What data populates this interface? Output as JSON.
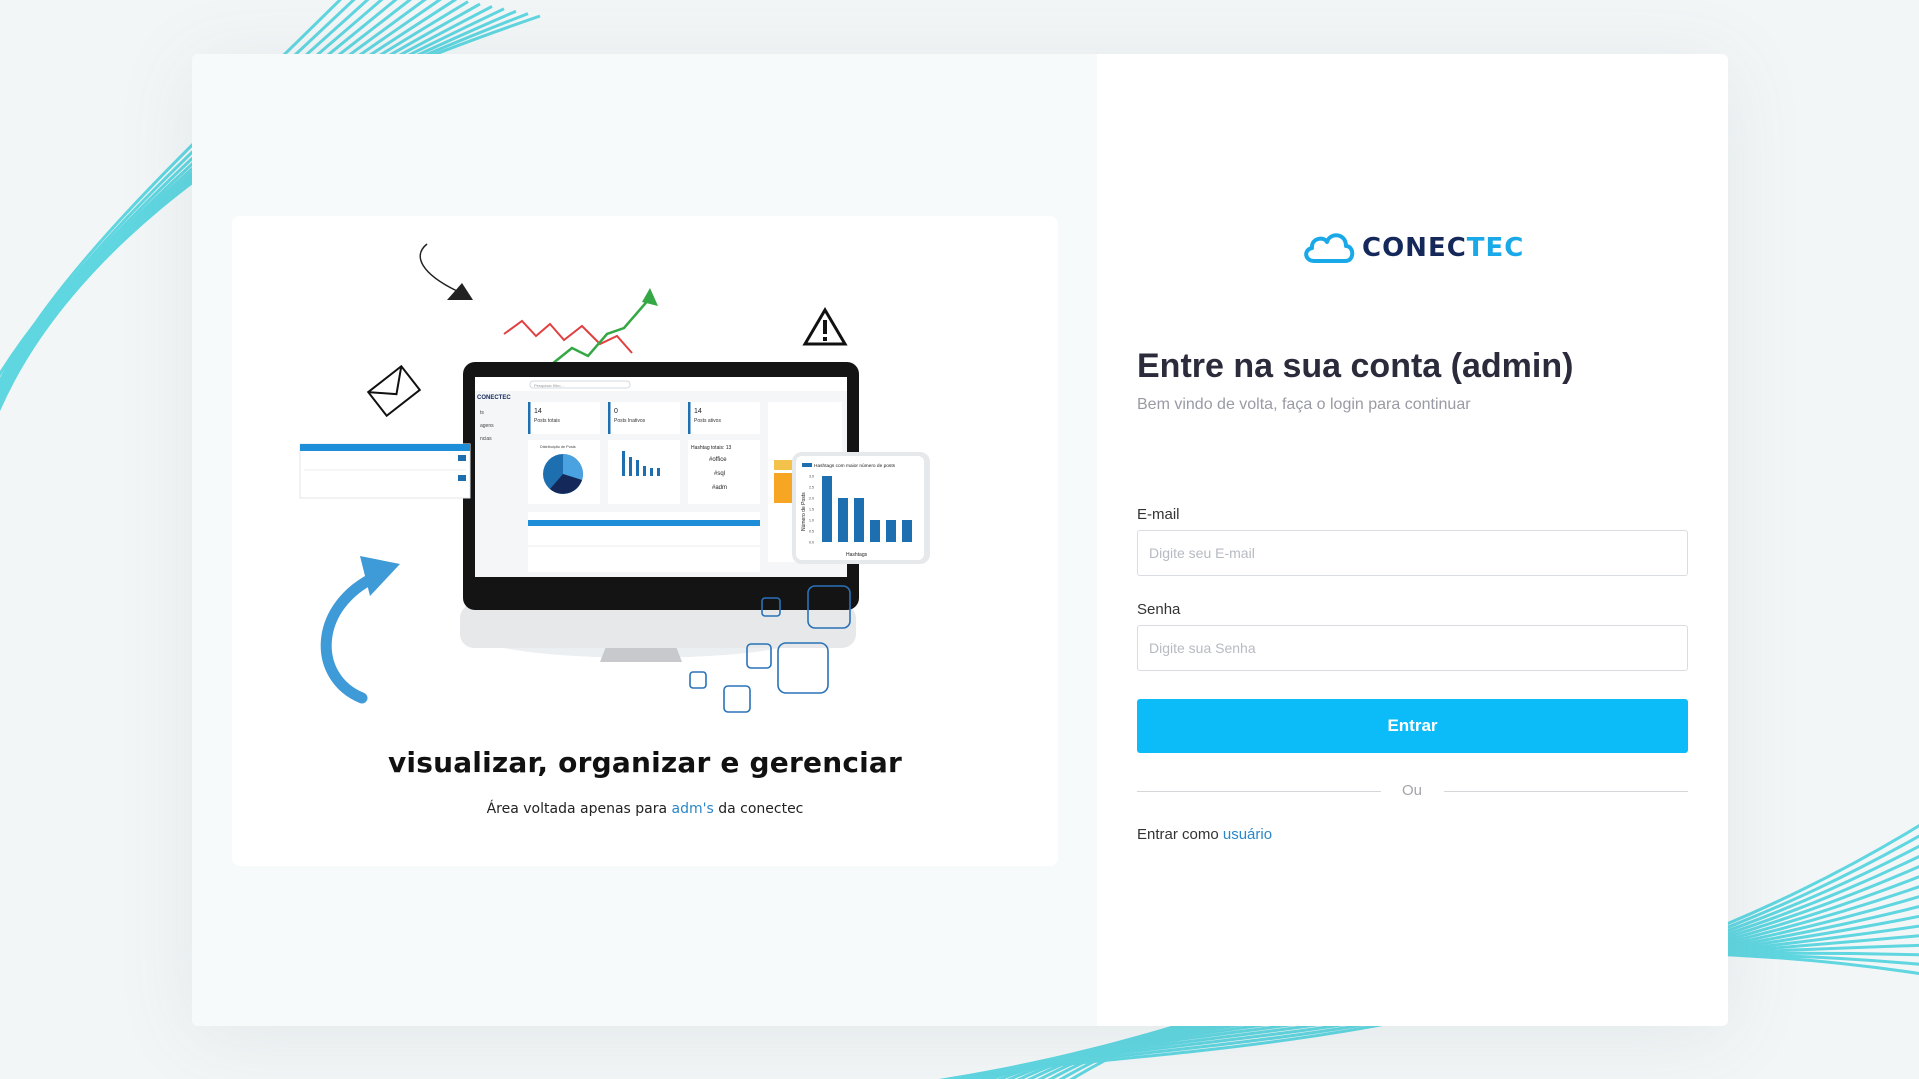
{
  "brand": {
    "logo_part1": "CONEC",
    "logo_part2": "TEC",
    "colors": {
      "navy": "#14285a",
      "accent": "#19a9e8",
      "button": "#0bbcf9",
      "wave": "#5fd6e0"
    }
  },
  "promo": {
    "title": "visualizar, organizar e gerenciar",
    "subtitle_before": "Área voltada apenas para ",
    "subtitle_accent": "adm's",
    "subtitle_after": " da conectec",
    "illustration_icons": [
      "mail-icon",
      "warning-icon",
      "trend-arrow-icon",
      "curved-arrow-icon"
    ]
  },
  "login": {
    "heading": "Entre na sua conta (admin)",
    "subheading": "Bem vindo de volta, faça o login para continuar",
    "email_label": "E-mail",
    "email_placeholder": "Digite seu E-mail",
    "password_label": "Senha",
    "password_placeholder": "Digite sua Senha",
    "submit_label": "Entrar",
    "divider_text": "Ou",
    "alt_prefix": "Entrar como ",
    "alt_link": "usuário"
  },
  "dashboard_preview": {
    "brand": "CONECTEC",
    "search_placeholder": "Pesquisar filtro...",
    "sidebar_items": [
      "ts",
      "agens",
      "ncias"
    ],
    "stats": [
      {
        "value": "14",
        "label": "Posts totais"
      },
      {
        "value": "0",
        "label": "Posts Inativos"
      },
      {
        "value": "14",
        "label": "Posts ativos"
      }
    ],
    "pie_title": "Distribuição de Posts",
    "hashtag_total": "Hashtag totais: 13",
    "hashtags": [
      "#office",
      "#sql",
      "#adm"
    ],
    "bar_chart": {
      "title": "Hashtags com maior número de posts",
      "ylabel": "Número de Posts",
      "xlabel": "Hashtags",
      "yticks": [
        "3.0",
        "2.5",
        "2.0",
        "1.5",
        "1.0",
        "0.5",
        "0.0"
      ],
      "values": [
        3,
        2,
        2,
        1,
        1,
        1
      ]
    }
  }
}
